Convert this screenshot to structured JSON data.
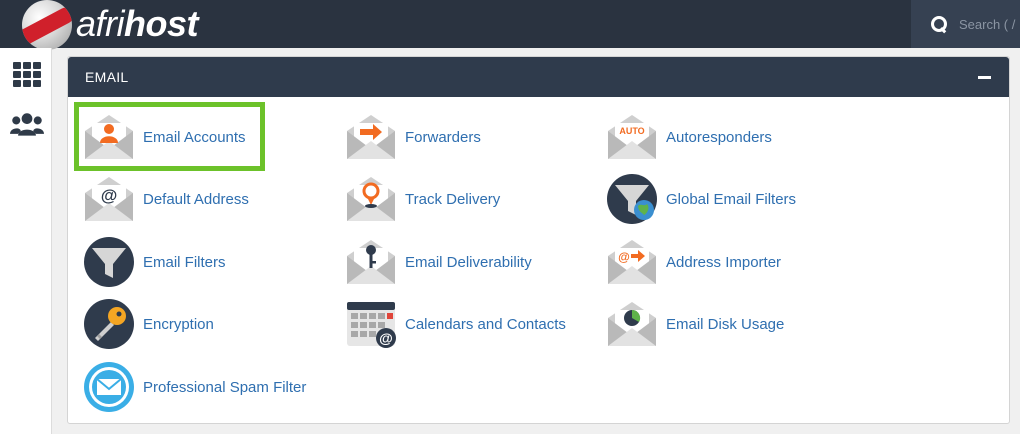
{
  "brand": {
    "name_light": "afri",
    "name_bold": "host"
  },
  "search": {
    "placeholder": "Search ( / )"
  },
  "section": {
    "title": "EMAIL"
  },
  "items": [
    {
      "label": "Email Accounts",
      "icon": "envelope-user-icon"
    },
    {
      "label": "Forwarders",
      "icon": "envelope-arrow-icon"
    },
    {
      "label": "Autoresponders",
      "icon": "envelope-auto-icon",
      "icon_text": "AUTO"
    },
    {
      "label": "Default Address",
      "icon": "envelope-at-icon"
    },
    {
      "label": "Track Delivery",
      "icon": "envelope-pin-icon"
    },
    {
      "label": "Global Email Filters",
      "icon": "funnel-globe-icon"
    },
    {
      "label": "Email Filters",
      "icon": "funnel-icon"
    },
    {
      "label": "Email Deliverability",
      "icon": "envelope-key-icon"
    },
    {
      "label": "Address Importer",
      "icon": "envelope-import-icon"
    },
    {
      "label": "Encryption",
      "icon": "key-icon"
    },
    {
      "label": "Calendars and Contacts",
      "icon": "calendar-icon"
    },
    {
      "label": "Email Disk Usage",
      "icon": "envelope-pie-icon"
    },
    {
      "label": "Professional Spam Filter",
      "icon": "spam-filter-icon"
    }
  ],
  "colors": {
    "topbar": "#2a3340",
    "panel_header": "#2f3b4c",
    "link": "#2f6fb0",
    "accent_orange": "#f26b21",
    "highlight_green": "#6cc22a"
  }
}
